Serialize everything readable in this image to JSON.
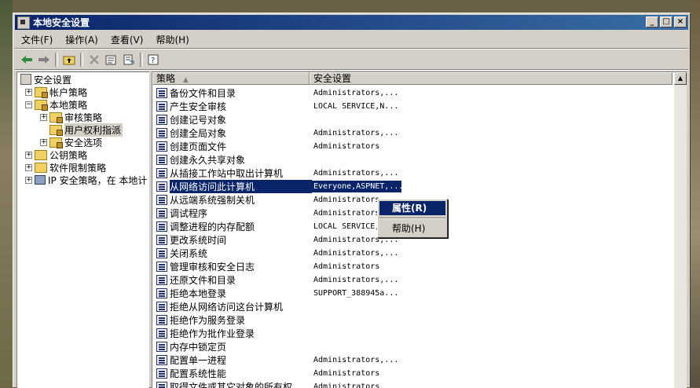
{
  "window": {
    "title": "本地安全设置"
  },
  "titlebar_buttons": {
    "minimize": "_",
    "maximize": "□",
    "close": "×"
  },
  "menu": [
    "文件(F)",
    "操作(A)",
    "查看(V)",
    "帮助(H)"
  ],
  "toolbar_icons": [
    "back-arrow-icon",
    "forward-arrow-icon",
    "up-folder-icon",
    "delete-icon",
    "properties-icon",
    "export-icon",
    "help-icon"
  ],
  "tree": [
    {
      "label": "安全设置",
      "level": 0,
      "expander": "",
      "icon": "security-settings-icon"
    },
    {
      "label": "帐户策略",
      "level": 1,
      "expander": "+",
      "icon": "folder-icon"
    },
    {
      "label": "本地策略",
      "level": 1,
      "expander": "−",
      "icon": "folder-icon"
    },
    {
      "label": "审核策略",
      "level": 2,
      "expander": "+",
      "icon": "folder-icon"
    },
    {
      "label": "用户权利指派",
      "level": 2,
      "expander": "",
      "icon": "folder-icon",
      "selected": true
    },
    {
      "label": "安全选项",
      "level": 2,
      "expander": "+",
      "icon": "folder-icon"
    },
    {
      "label": "公钥策略",
      "level": 1,
      "expander": "+",
      "icon": "folder-icon"
    },
    {
      "label": "软件限制策略",
      "level": 1,
      "expander": "+",
      "icon": "folder-icon"
    },
    {
      "label": "IP 安全策略，在 本地计",
      "level": 1,
      "expander": "+",
      "icon": "computer-icon"
    }
  ],
  "columns": {
    "policy": "策略",
    "setting": "安全设置"
  },
  "rows": [
    {
      "policy": "备份文件和目录",
      "setting": "Administrators,..."
    },
    {
      "policy": "产生安全审核",
      "setting": "LOCAL SERVICE,N..."
    },
    {
      "policy": "创建记号对象",
      "setting": ""
    },
    {
      "policy": "创建全局对象",
      "setting": "Administrators,..."
    },
    {
      "policy": "创建页面文件",
      "setting": "Administrators"
    },
    {
      "policy": "创建永久共享对象",
      "setting": ""
    },
    {
      "policy": "从插接工作站中取出计算机",
      "setting": "Administrators,..."
    },
    {
      "policy": "从网络访问此计算机",
      "setting": "Everyone,ASPNET,...",
      "selected": true
    },
    {
      "policy": "从远端系统强制关机",
      "setting": "Administrators"
    },
    {
      "policy": "调试程序",
      "setting": "Administrators"
    },
    {
      "policy": "调整进程的内存配额",
      "setting": "LOCAL SERVICE,N..."
    },
    {
      "policy": "更改系统时间",
      "setting": "Administrators,..."
    },
    {
      "policy": "关闭系统",
      "setting": "Administrators,..."
    },
    {
      "policy": "管理审核和安全日志",
      "setting": "Administrators"
    },
    {
      "policy": "还原文件和目录",
      "setting": "Administrators,..."
    },
    {
      "policy": "拒绝本地登录",
      "setting": "SUPPORT_388945a..."
    },
    {
      "policy": "拒绝从网络访问这台计算机",
      "setting": ""
    },
    {
      "policy": "拒绝作为服务登录",
      "setting": ""
    },
    {
      "policy": "拒绝作为批作业登录",
      "setting": ""
    },
    {
      "policy": "内存中锁定页",
      "setting": ""
    },
    {
      "policy": "配置单一进程",
      "setting": "Administrators,..."
    },
    {
      "policy": "配置系统性能",
      "setting": "Administrators"
    },
    {
      "policy": "取得文件或其它对象的所有权",
      "setting": "Administrators"
    }
  ],
  "context_menu": {
    "properties": "属性(R)",
    "help": "帮助(H)"
  }
}
